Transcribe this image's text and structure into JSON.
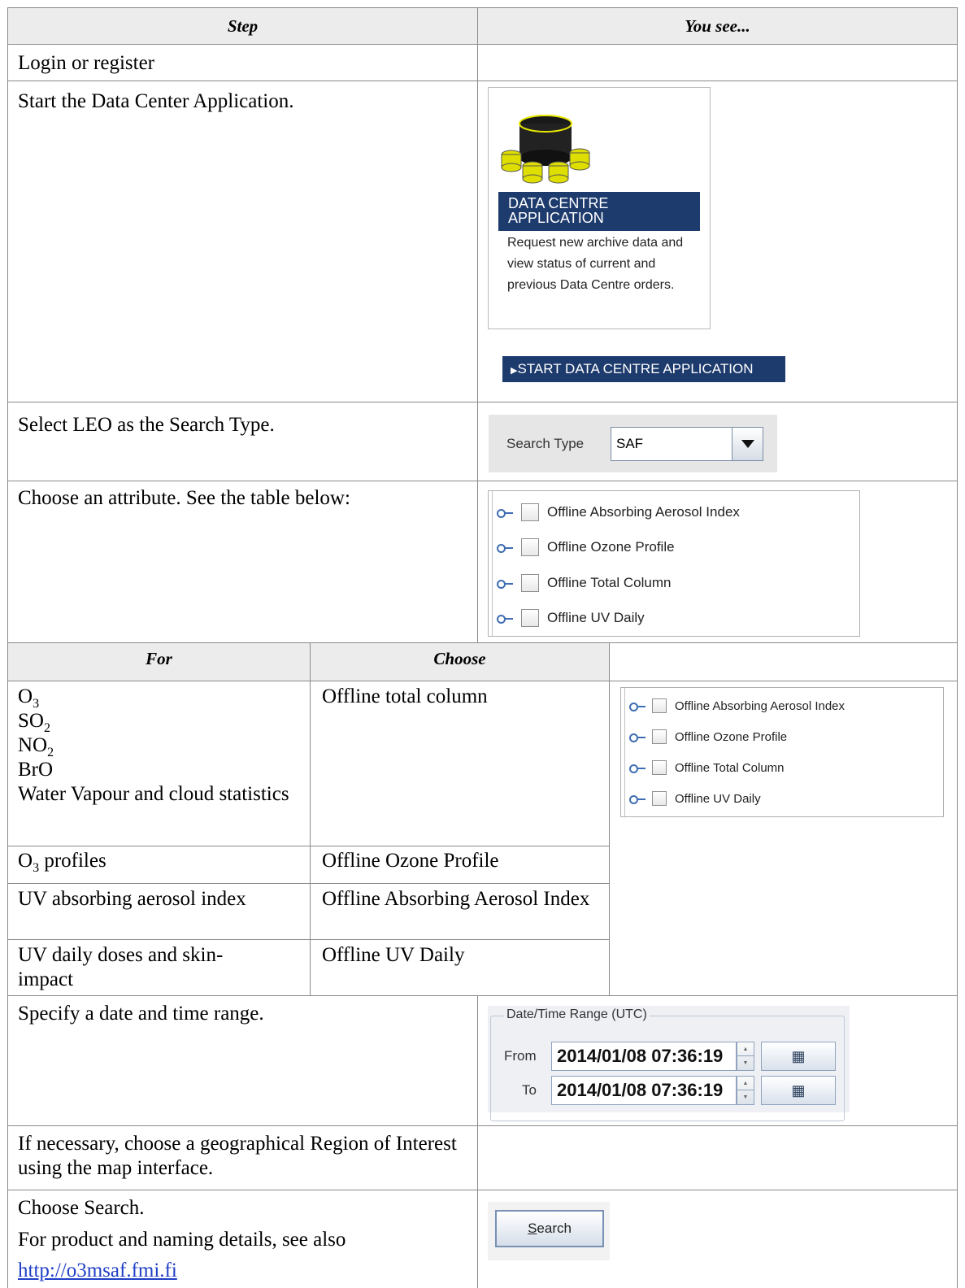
{
  "header": {
    "step": "Step",
    "you_see": "You see..."
  },
  "rows": {
    "login": "Login or register",
    "start": "Start the Data Center Application.",
    "select": "Select LEO as the Search Type.",
    "attribute": "Choose an attribute. See the table below:",
    "daterange": "Specify a date and time range.",
    "region": "If necessary, choose a geographical Region of Interest using the map interface.",
    "search": "Choose Search.",
    "search_note": "For product and naming details, see also",
    "search_link": "http://o3msaf.fmi.fi"
  },
  "app_card": {
    "title": "DATA CENTRE APPLICATION",
    "desc": "Request new archive data and view status of current and previous Data Centre orders.",
    "start_button": "START DATA CENTRE APPLICATION"
  },
  "search_type": {
    "label": "Search Type",
    "value": "SAF"
  },
  "attributes": [
    "Offline Absorbing Aerosol Index",
    "Offline Ozone Profile",
    "Offline Total Column",
    "Offline UV Daily"
  ],
  "subtable": {
    "col_for": "For",
    "col_choose": "Choose",
    "rows": [
      {
        "for_lines": [
          "O3",
          "SO2",
          "NO2",
          "BrO",
          "Water Vapour and cloud statistics"
        ],
        "choose": "Offline total column"
      },
      {
        "for": "O3 profiles",
        "choose": "Offline Ozone Profile"
      },
      {
        "for": "UV absorbing aerosol index",
        "choose": "Offline Absorbing Aerosol Index"
      },
      {
        "for": "UV daily doses and skin-impact",
        "choose": "Offline UV Daily"
      }
    ]
  },
  "date_range": {
    "legend": "Date/Time Range (UTC)",
    "from_label": "From",
    "from_value": "2014/01/08 07:36:19",
    "to_label": "To",
    "to_value": "2014/01/08 07:36:19"
  },
  "search_button": {
    "label": "Search",
    "mnemonic": "S"
  },
  "colors": {
    "header_bg": "#ececec",
    "app_bar": "#1e3b6d",
    "link": "#1f3fc6"
  }
}
